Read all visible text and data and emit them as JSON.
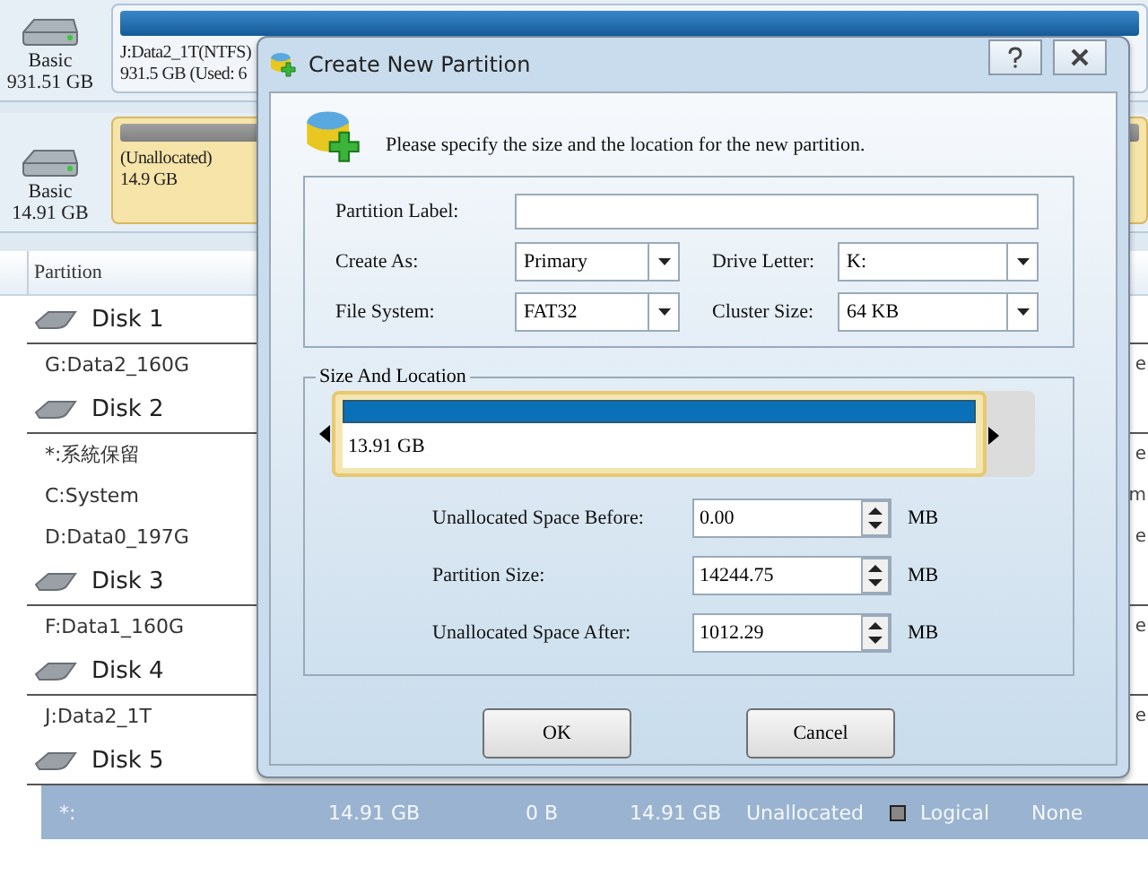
{
  "disk_map": [
    {
      "type": "Basic",
      "size": "931.51 GB",
      "partition": {
        "name": "J:Data2_1T(NTFS)",
        "detail": "931.5 GB (Used: 6",
        "selected": false
      }
    },
    {
      "type": "Basic",
      "size": "14.91 GB",
      "partition": {
        "name": "(Unallocated)",
        "detail": "14.9 GB",
        "selected": true
      }
    }
  ],
  "table": {
    "columns": [
      "Partition"
    ],
    "groups": [
      {
        "disk": "Disk 1",
        "rows": [
          {
            "partition": "G:Data2_160G",
            "tail": "e",
            "selected": false
          }
        ]
      },
      {
        "disk": "Disk 2",
        "rows": [
          {
            "partition": "*:系統保留",
            "tail": "e",
            "selected": false
          },
          {
            "partition": "C:System",
            "tail": "m",
            "selected": false
          },
          {
            "partition": "D:Data0_197G",
            "tail": "e",
            "selected": false
          }
        ]
      },
      {
        "disk": "Disk 3",
        "rows": [
          {
            "partition": "F:Data1_160G",
            "tail": "e",
            "selected": false
          }
        ]
      },
      {
        "disk": "Disk 4",
        "rows": [
          {
            "partition": "J:Data2_1T",
            "tail": "e",
            "selected": false
          }
        ]
      },
      {
        "disk": "Disk 5",
        "rows": [
          {
            "partition": "*:",
            "cells": [
              "14.91 GB",
              "0 B",
              "14.91 GB",
              "Unallocated"
            ],
            "type": "Logical",
            "status": "None",
            "selected": true
          }
        ]
      }
    ]
  },
  "dialog": {
    "title": "Create New Partition",
    "intro": "Please specify the size and the location for the new partition.",
    "field_rows": [
      [
        {
          "label": "Partition Label:",
          "kind": "text"
        }
      ],
      [
        {
          "label": "Create As:",
          "kind": "select",
          "value": "Primary"
        },
        {
          "label": "Drive Letter:",
          "kind": "select",
          "value": "K:"
        }
      ],
      [
        {
          "label": "File System:",
          "kind": "select",
          "value": "FAT32"
        },
        {
          "label": "Cluster Size:",
          "kind": "select",
          "value": "64 KB"
        }
      ]
    ],
    "size_location": {
      "title": "Size And Location",
      "bar_label": "13.91 GB",
      "level": 0.93,
      "spins": [
        {
          "label": "Unallocated Space Before:",
          "value": "0.00",
          "unit": "MB"
        },
        {
          "label": "Partition Size:",
          "value": "14244.75",
          "unit": "MB"
        },
        {
          "label": "Unallocated Space After:",
          "value": "1012.29",
          "unit": "MB"
        }
      ]
    },
    "buttons": [
      "OK",
      "Cancel"
    ]
  }
}
